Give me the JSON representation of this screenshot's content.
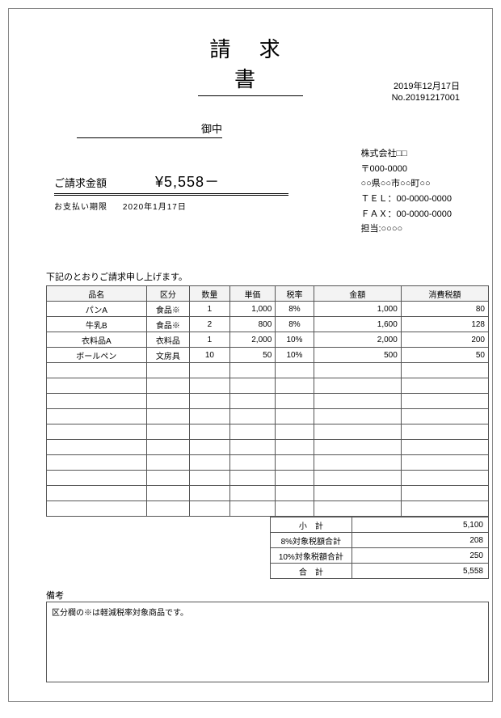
{
  "title": "請 求 書",
  "header": {
    "date": "2019年12月17日",
    "number": "No.20191217001"
  },
  "addressee_suffix": "御中",
  "amount": {
    "label": "ご請求金額",
    "value": "¥5,558－"
  },
  "due": {
    "label": "お支払い期限",
    "value": "2020年1月17日"
  },
  "sender": {
    "company": "株式会社□□",
    "postal": "〒000-0000",
    "address": "○○県○○市○○町○○",
    "tel": "ＴＥＬ：00-0000-0000",
    "fax": "ＦＡＸ：00-0000-0000",
    "contact": "担当:○○○○"
  },
  "preamble": "下記のとおりご請求申し上げます。",
  "columns": {
    "name": "品名",
    "type": "区分",
    "qty": "数量",
    "unit": "単価",
    "rate": "税率",
    "amount": "金額",
    "tax": "消費税額"
  },
  "rows": [
    {
      "name": "パンA",
      "type": "食品※",
      "qty": "1",
      "unit": "1,000",
      "rate": "8%",
      "amount": "1,000",
      "tax": "80"
    },
    {
      "name": "牛乳B",
      "type": "食品※",
      "qty": "2",
      "unit": "800",
      "rate": "8%",
      "amount": "1,600",
      "tax": "128"
    },
    {
      "name": "衣料品A",
      "type": "衣料品",
      "qty": "1",
      "unit": "2,000",
      "rate": "10%",
      "amount": "2,000",
      "tax": "200"
    },
    {
      "name": "ボールペン",
      "type": "文房具",
      "qty": "10",
      "unit": "50",
      "rate": "10%",
      "amount": "500",
      "tax": "50"
    }
  ],
  "empty_rows": 10,
  "summary": {
    "subtotal_label": "小　計",
    "subtotal": "5,100",
    "tax8_label": "8%対象税額合計",
    "tax8": "208",
    "tax10_label": "10%対象税額合計",
    "tax10": "250",
    "total_label": "合　計",
    "total": "5,558"
  },
  "remarks": {
    "label": "備考",
    "text": "区分欄の※は軽減税率対象商品です。"
  }
}
